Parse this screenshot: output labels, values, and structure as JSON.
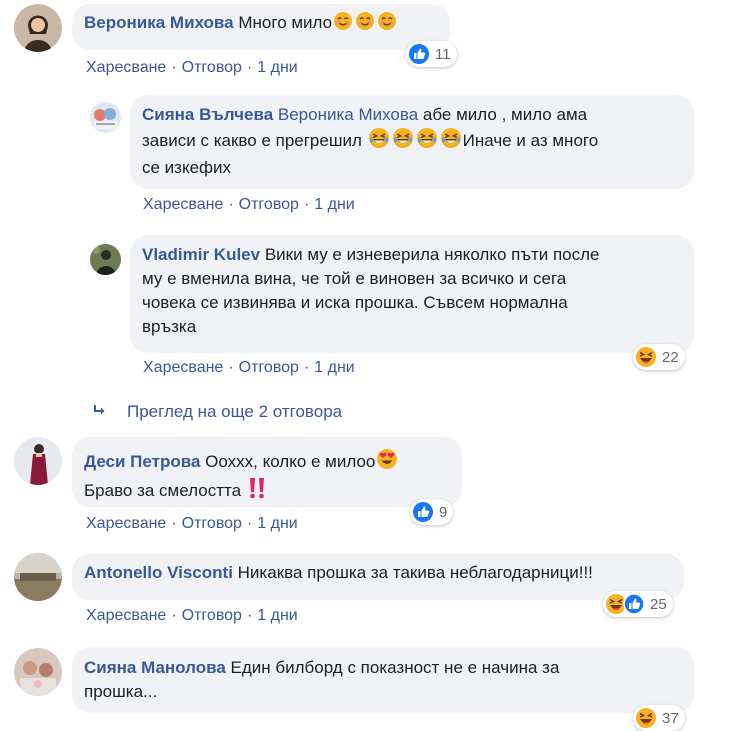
{
  "comments": [
    {
      "author": "Вероника Михова",
      "text": "Много мило",
      "like": "Харесване",
      "reply": "Отговор",
      "time": "1 дни",
      "reaction_count": "11"
    },
    {
      "author": "Сияна Вълчева",
      "mention": "Вероника Михова",
      "text_line1": "абе мило , мило ама",
      "text_line2_a": "зависи с какво е прегрешил",
      "text_line2_b": "Иначе и аз много",
      "text_line3": "се изкефих",
      "like": "Харесване",
      "reply": "Отговор",
      "time": "1 дни"
    },
    {
      "author": "Vladimir Kulev",
      "text_line1": "Вики му е изневерила няколко пъти после",
      "text_line2": "му е вменила вина, че той е виновен за всичко и сега",
      "text_line3": "човека се извинява и иска прошка. Съвсем нормална",
      "text_line4": "връзка",
      "like": "Харесване",
      "reply": "Отговор",
      "time": "1 дни",
      "reaction_count": "22"
    },
    {
      "more_replies": "Преглед на още 2 отговора"
    },
    {
      "author": "Деси Петрова",
      "text_line1": "Ооххх, колко е милоо",
      "text_line2": "Браво за смелостта",
      "like": "Харесване",
      "reply": "Отговор",
      "time": "1 дни",
      "reaction_count": "9"
    },
    {
      "author": "Antonello Visconti",
      "text": "Никаква прошка за такива неблагодарници!!!",
      "like": "Харесване",
      "reply": "Отговор",
      "time": "1 дни",
      "reaction_count": "25"
    },
    {
      "author": "Сияна Манолова",
      "text_line1": "Един билборд с показност не е начина за",
      "text_line2": "прошка...",
      "reaction_count": "37"
    }
  ],
  "colors": {
    "link": "#385898",
    "bubble": "#f0f2f5",
    "like_blue": "#1877f2",
    "emoji_yellow": "#f7b125"
  }
}
